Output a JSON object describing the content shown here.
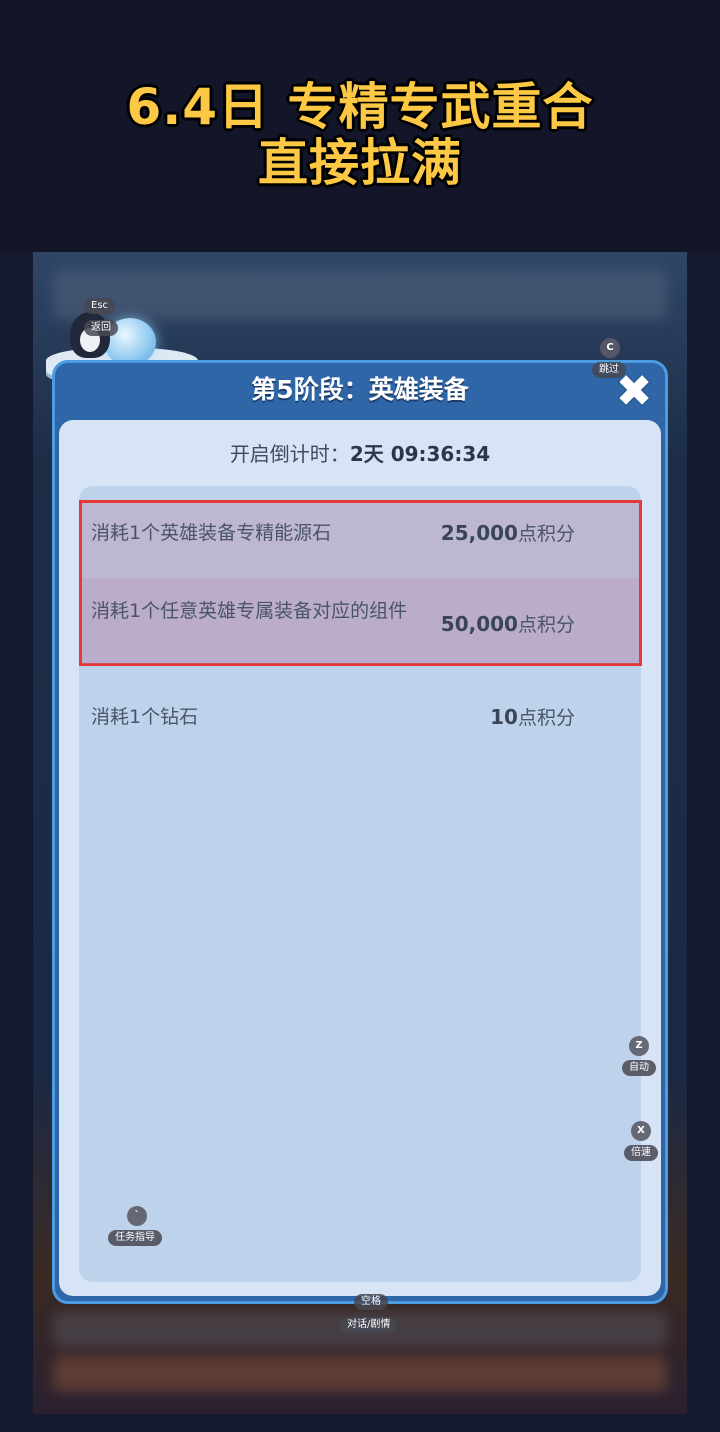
{
  "headline": {
    "line1": "6.4日 专精专武重合",
    "line2": "直接拉满"
  },
  "hotkeys": {
    "esc_key": "Esc",
    "esc_label": "返回",
    "skip_key": "C",
    "skip_label": "跳过",
    "auto_key": "Z",
    "auto_label": "自动",
    "speed_key": "X",
    "speed_label": "倍速",
    "guide_key": "`",
    "guide_label": "任务指导",
    "space_key": "空格",
    "space_label": "对话/剧情"
  },
  "dialog": {
    "title": "第5阶段：英雄装备",
    "countdown_label": "开启倒计时：",
    "countdown_value": "2天 09:36:34",
    "rows": [
      {
        "label": "消耗1个英雄装备专精能源石",
        "points": "25,000",
        "unit": "点积分",
        "highlighted": true
      },
      {
        "label": "消耗1个任意英雄专属装备对应的组件",
        "points": "50,000",
        "unit": "点积分",
        "highlighted": true
      },
      {
        "label": "消耗1个钻石",
        "points": "10",
        "unit": "点积分",
        "highlighted": false
      }
    ]
  },
  "colors": {
    "headline_text": "#fdc843",
    "dialog_frame": "#2f66a8",
    "highlight_border": "#e53838"
  }
}
